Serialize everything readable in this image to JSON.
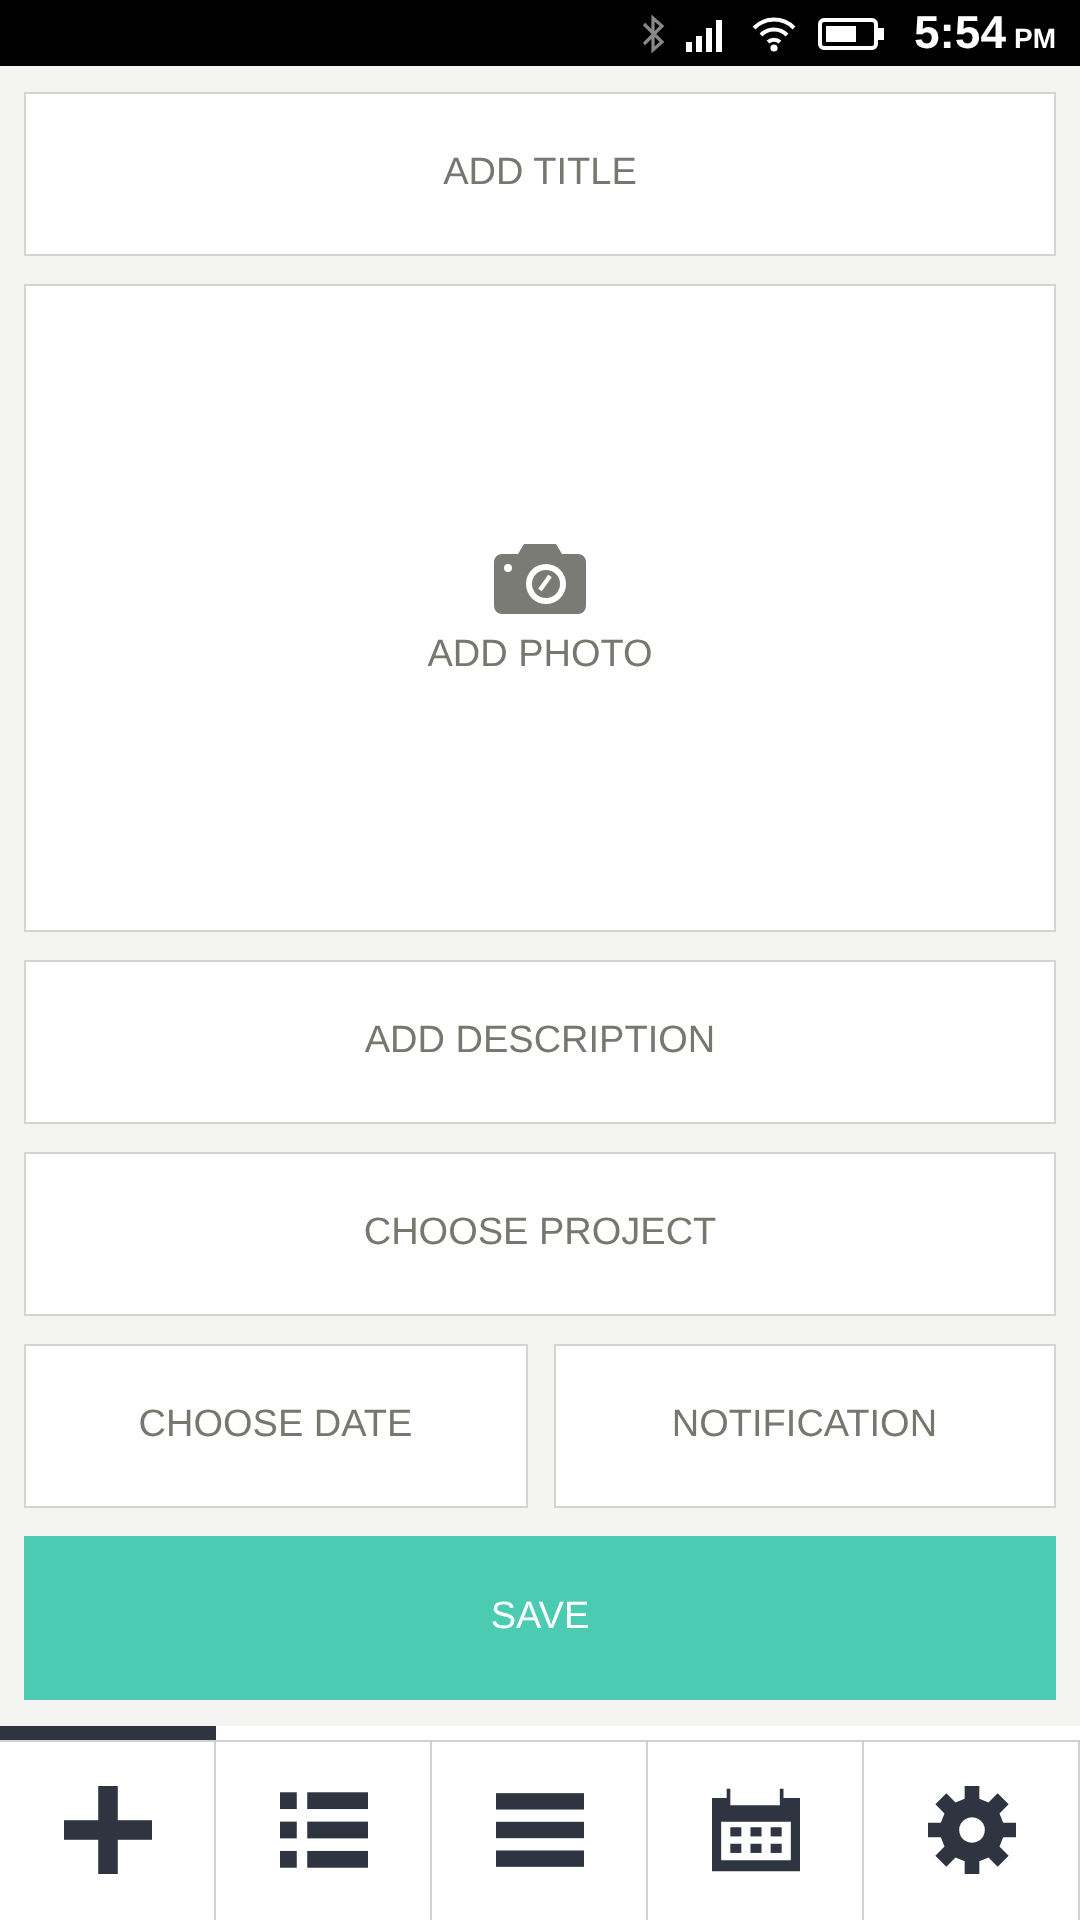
{
  "status_bar": {
    "time": "5:54",
    "meridiem": "PM"
  },
  "form": {
    "title_field": {
      "placeholder": "ADD TITLE"
    },
    "photo": {
      "label": "ADD PHOTO"
    },
    "description_field": {
      "placeholder": "ADD DESCRIPTION"
    },
    "project_button": "CHOOSE PROJECT",
    "date_button": "CHOOSE DATE",
    "notification_button": "NOTIFICATION",
    "save_button": "SAVE"
  },
  "tabs": [
    {
      "kind": "add",
      "selected": true
    },
    {
      "kind": "list",
      "selected": false
    },
    {
      "kind": "menu",
      "selected": false
    },
    {
      "kind": "calendar",
      "selected": false
    },
    {
      "kind": "settings",
      "selected": false
    }
  ]
}
